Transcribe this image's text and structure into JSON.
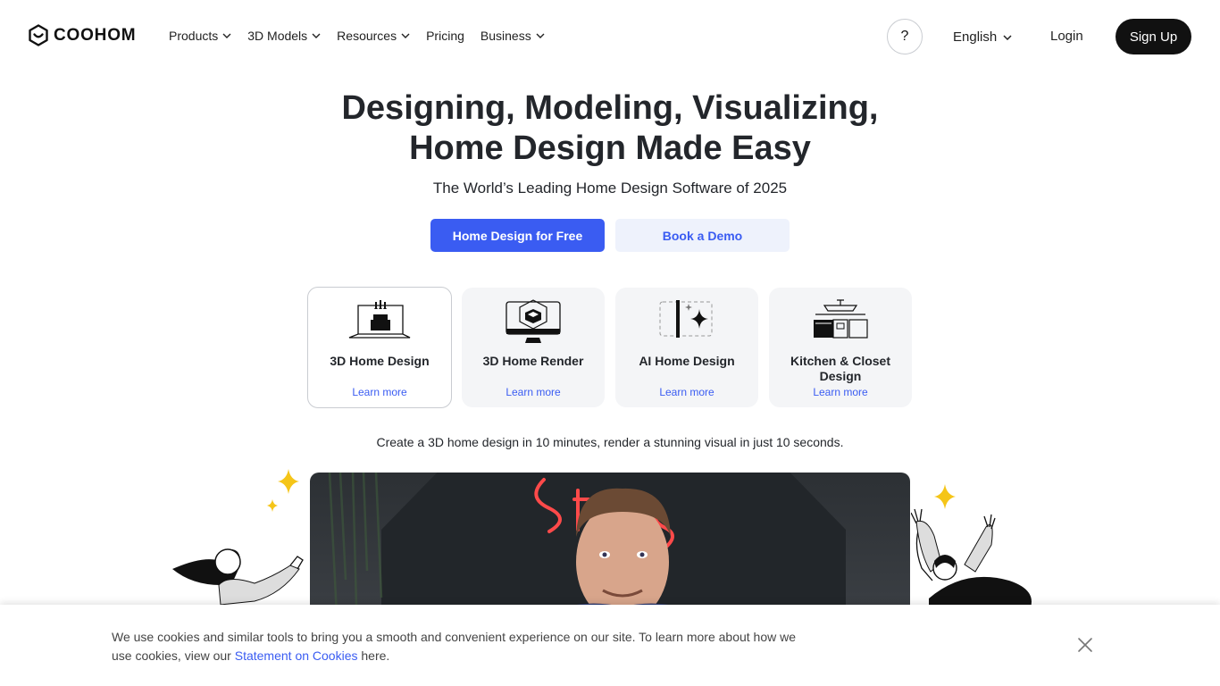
{
  "header": {
    "logo_text": "COOHOM",
    "nav": [
      {
        "label": "Products",
        "has_dropdown": true
      },
      {
        "label": "3D Models",
        "has_dropdown": true
      },
      {
        "label": "Resources",
        "has_dropdown": true
      },
      {
        "label": "Pricing",
        "has_dropdown": false
      },
      {
        "label": "Business",
        "has_dropdown": true
      }
    ],
    "help_label": "?",
    "language": "English",
    "login_label": "Login",
    "signup_label": "Sign Up"
  },
  "hero": {
    "title_line1": "Designing, Modeling, Visualizing,",
    "title_line2": "Home Design Made Easy",
    "subtitle": "The World’s Leading Home Design Software of 2025",
    "cta_primary": "Home Design for Free",
    "cta_secondary": "Book a Demo"
  },
  "cards": [
    {
      "title": "3D Home Design",
      "link": "Learn more",
      "icon": "3d-home-design-icon",
      "active": true
    },
    {
      "title": "3D Home Render",
      "link": "Learn more",
      "icon": "3d-home-render-icon",
      "active": false
    },
    {
      "title": "AI Home Design",
      "link": "Learn more",
      "icon": "ai-home-design-icon",
      "active": false
    },
    {
      "title": "Kitchen & Closet Design",
      "link": "Learn more",
      "icon": "kitchen-closet-icon",
      "active": false
    }
  ],
  "tagline": "Create a 3D home design in 10 minutes, render a stunning visual in just 10 seconds.",
  "cookie": {
    "text_before": "We use cookies and similar tools to bring you a smooth and convenient experience on our site. To learn more about how we use cookies, view our ",
    "link_text": "Statement on Cookies",
    "text_after": " here."
  },
  "colors": {
    "accent": "#3a5cf2",
    "accent_light": "#eef2fc",
    "dark": "#111111",
    "card_bg": "#f4f5f7",
    "sparkle": "#f5c518"
  }
}
